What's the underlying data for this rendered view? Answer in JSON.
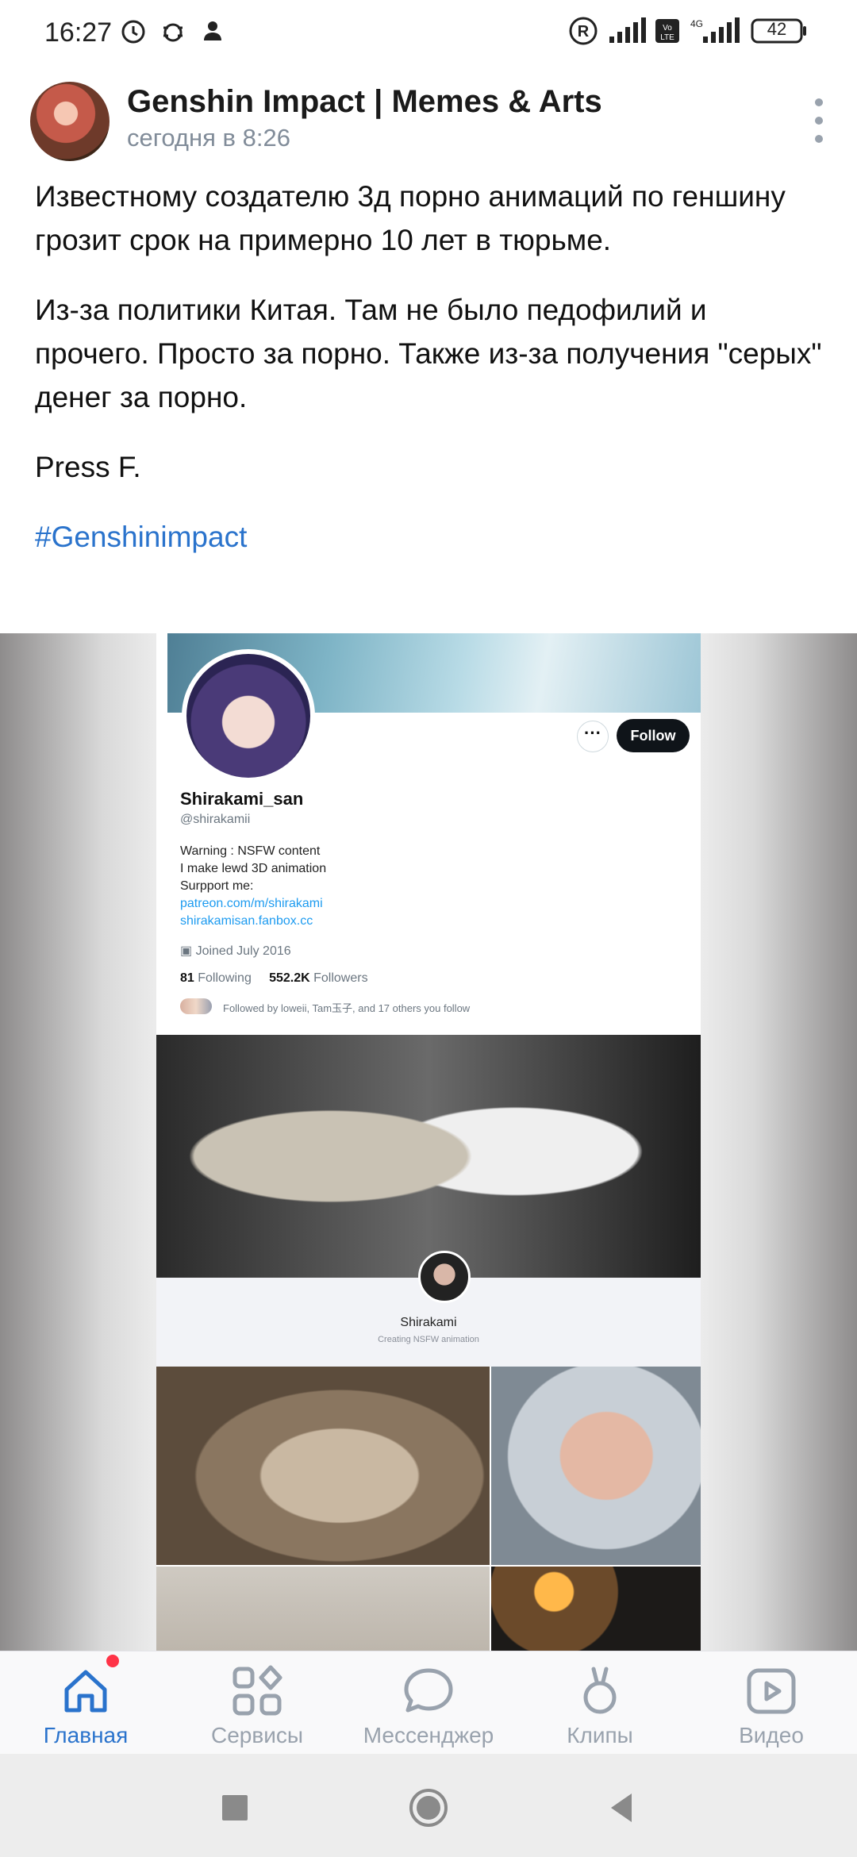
{
  "status_bar": {
    "time": "16:27",
    "battery": "42"
  },
  "post": {
    "group_name": "Genshin Impact | Memes & Arts",
    "time": "сегодня в 8:26",
    "paragraphs": [
      "Известному создателю 3д порно анимаций по геншину грозит срок на примерно 10 лет в тюрьме.",
      "Из-за политики Китая. Там не было педофилий и прочего. Просто за порно. Также из-за получения \"серых\" денег за порно.",
      "Press F."
    ],
    "hashtag": "#Genshinimpact"
  },
  "screenshot": {
    "follow_label": "Follow",
    "more_label": "···",
    "name": "Shirakami_san",
    "handle": "@shirakamii",
    "bio_lines": [
      "Warning : NSFW content",
      "I make lewd 3D animation",
      "Surpport me:"
    ],
    "links": [
      "patreon.com/m/shirakami",
      "shirakamisan.fanbox.cc"
    ],
    "joined": "Joined July 2016",
    "following_count": "81",
    "following_label": "Following",
    "followers_count": "552.2K",
    "followers_label": "Followers",
    "followed_by": "Followed by loweii, Tam玉子, and 17 others you follow",
    "patreon_name": "Shirakami",
    "patreon_tagline": "Creating NSFW animation"
  },
  "bottom_nav": {
    "items": [
      {
        "label": "Главная",
        "icon": "home-icon",
        "active": true
      },
      {
        "label": "Сервисы",
        "icon": "services-icon",
        "active": false
      },
      {
        "label": "Мессенджер",
        "icon": "messenger-icon",
        "active": false
      },
      {
        "label": "Клипы",
        "icon": "clips-icon",
        "active": false
      },
      {
        "label": "Видео",
        "icon": "video-icon",
        "active": false
      }
    ]
  },
  "colors": {
    "accent": "#2a73cc",
    "secondary_text": "#818c99",
    "nav_inactive": "#99a2ad",
    "badge": "#ff3347"
  }
}
